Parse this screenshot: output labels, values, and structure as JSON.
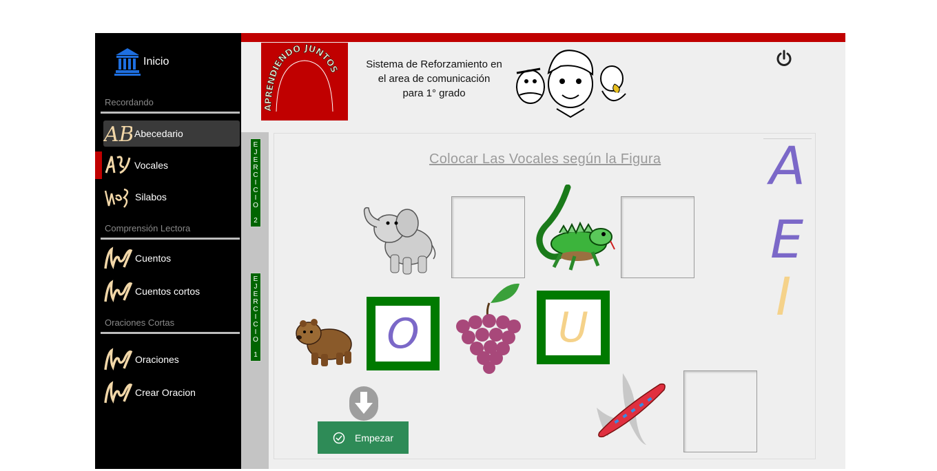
{
  "sidebar": {
    "home_label": "Inicio",
    "sections": [
      {
        "title": "Recordando"
      },
      {
        "title": "Comprensión Lectora"
      },
      {
        "title": "Oraciones Cortas"
      }
    ],
    "items": [
      {
        "label": "Abecedario",
        "icon": "ab-icon"
      },
      {
        "label": "Vocales",
        "icon": "vocales-icon"
      },
      {
        "label": "Silabos",
        "icon": "silabos-icon"
      },
      {
        "label": "Cuentos",
        "icon": "lectura-icon"
      },
      {
        "label": "Cuentos cortos",
        "icon": "lectura-icon"
      },
      {
        "label": "Oraciones",
        "icon": "lectura-icon"
      },
      {
        "label": "Crear Oracion",
        "icon": "lectura-icon"
      }
    ],
    "active_item": "Abecedario",
    "current_item": "Vocales"
  },
  "header": {
    "logo_text": "APRENDIENDO JUNTOS",
    "subtitle": "Sistema de Reforzamiento en\nel area de comunicación\npara 1° grado",
    "power_icon": "power-icon"
  },
  "exercises": [
    {
      "label": "E\nJ\nE\nR\nC\nI\nC\nI\nO\n\n2"
    },
    {
      "label": "E\nJ\nE\nR\nC\nI\nC\nI\nO\n\n1"
    }
  ],
  "activity": {
    "title": "Colocar Las Vocales según la Figura",
    "figures": [
      {
        "name": "elephant",
        "answer": ""
      },
      {
        "name": "iguana",
        "answer": ""
      },
      {
        "name": "bear",
        "answer": "O"
      },
      {
        "name": "grapes",
        "answer": "U"
      },
      {
        "name": "airplane",
        "answer": ""
      }
    ],
    "letter_bank": [
      "A",
      "E",
      "I"
    ],
    "start_label": "Empezar"
  },
  "colors": {
    "accent_red": "#c00000",
    "green": "#007a00",
    "vowel_purple": "#7b68c8",
    "vowel_yellow": "#f5d28a",
    "button_green": "#2e8b57"
  }
}
